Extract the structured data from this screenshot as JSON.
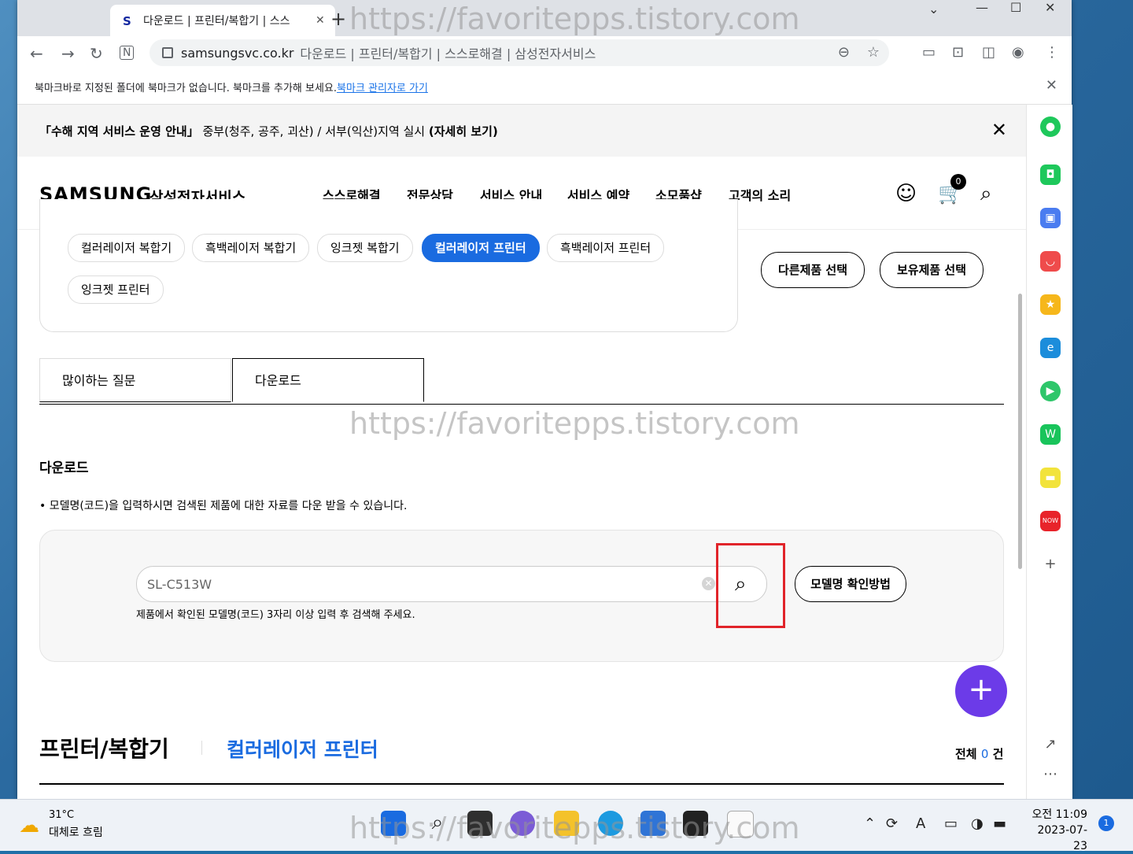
{
  "browser": {
    "tab_title": "다운로드 | 프린터/복합기 | 스스",
    "tab_favicon": "S",
    "url_domain": "samsungsvc.co.kr",
    "url_rest": "다운로드 | 프린터/복합기 | 스스로해결 | 삼성전자서비스",
    "bookmark_msg": "북마크바로 지정된 폴더에 북마크가 없습니다. 북마크를 추가해 보세요.",
    "bookmark_link": "북마크 관리자로 가기"
  },
  "notice": {
    "text_bold": "「수해 지역 서비스 운영 안내」",
    "text_mid": " 중부(청주, 공주, 괴산) / 서부(익산)지역 실시 ",
    "text_link": "(자세히 보기)"
  },
  "header": {
    "logo": "SAMSUNG",
    "logo_sub": "삼성전자서비스",
    "menu": [
      "스스로해결",
      "전문상담",
      "서비스 안내",
      "서비스 예약",
      "소모품샵",
      "고객의 소리"
    ],
    "cart_count": "0"
  },
  "categories": {
    "chips": [
      "컬러레이저 복합기",
      "흑백레이저 복합기",
      "잉크젯 복합기",
      "컬러레이저 프린터",
      "흑백레이저 프린터",
      "잉크젯 프린터"
    ],
    "selected": "컬러레이저 프린터",
    "btn_other": "다른제품 선택",
    "btn_owned": "보유제품 선택"
  },
  "tabs": [
    "많이하는 질문",
    "다운로드"
  ],
  "download": {
    "title": "다운로드",
    "bullet": "• 모델명(코드)을 입력하시면 검색된 제품에 대한 자료를 다운 받을 수 있습니다.",
    "search_value": "SL-C513W",
    "hint": "제품에서 확인된 모델명(코드) 3자리 이상 입력 후 검색해 주세요.",
    "model_btn": "모델명 확인방법"
  },
  "products": {
    "title": "프린터/복합기",
    "subtitle": "컬러레이저 프린터",
    "total_prefix": "전체 ",
    "total_count": "0",
    "total_suffix": " 건"
  },
  "watermark": "https://favoritepps.tistory.com",
  "taskbar": {
    "temp": "31°C",
    "weather": "대체로 흐림",
    "time": "오전 11:09",
    "date": "2023-07-23",
    "notif_count": "1",
    "ime": "A"
  },
  "colors": {
    "accent": "#1a6be0",
    "fab": "#6c3be8",
    "highlight": "#e1242a"
  }
}
